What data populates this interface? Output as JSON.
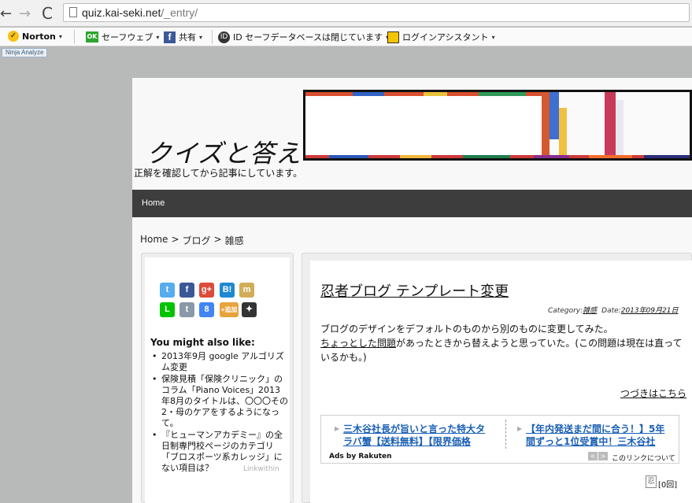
{
  "browser": {
    "url_host": "quiz.kai-seki.net",
    "url_path": "/_entry/",
    "back_icon": "←",
    "forward_icon": "→",
    "reload_icon": "C"
  },
  "toolbar": {
    "norton_label": "Norton",
    "safeweb_label": "セーフウェブ",
    "share_label": "共有",
    "id_safe_label": "ID セーフデータベースは閉じています",
    "login_assistant_label": "ログインアシスタント",
    "ok_badge": "OK",
    "fb_badge": "f",
    "id_badge": "ID",
    "caret": "▾"
  },
  "ninja_analyze_label": "Ninja Analyze",
  "site": {
    "title": "クイズと答え",
    "description": "正解を確認してから記事にしています。"
  },
  "nav": {
    "home_label": "Home"
  },
  "breadcrumb": {
    "items": [
      "Home",
      "ブログ",
      "雑感"
    ],
    "separator": ">"
  },
  "sidebar": {
    "share_icons": [
      {
        "name": "twitter-icon",
        "glyph": "t",
        "color": "#55acee"
      },
      {
        "name": "facebook-icon",
        "glyph": "f",
        "color": "#3b5998"
      },
      {
        "name": "google-plus-icon",
        "glyph": "g+",
        "color": "#dd4b39"
      },
      {
        "name": "hatena-bookmark-icon",
        "glyph": "B!",
        "color": "#1e88d3"
      },
      {
        "name": "mixi-icon",
        "glyph": "m",
        "color": "#d1ad59"
      },
      {
        "name": "line-icon",
        "glyph": "L",
        "color": "#00c300"
      },
      {
        "name": "tumblr-icon",
        "glyph": "t",
        "color": "#8a98a8"
      },
      {
        "name": "google-bookmark-icon",
        "glyph": "8",
        "color": "#4285f4"
      },
      {
        "name": "add-button-icon",
        "glyph": "+追加",
        "color": "#e8a33c"
      },
      {
        "name": "ninja-star-icon",
        "glyph": "✦",
        "color": "#333333"
      }
    ],
    "ymal_title": "You might also like:",
    "ymal_items": [
      "2013年9月 google アルゴリズム変更",
      "保険見積「保険クリニック」のコラム「Piano Voices」2013年8月のタイトルは、〇〇〇その2・母のケアをするようになって。",
      "『ヒューマンアカデミー』の全日制専門校ページのカテゴリ「ブロスポーツ系カレッジ」にない項目は？"
    ],
    "linkwithin_label": "Linkwithin"
  },
  "post": {
    "title": "忍者ブログ テンプレート変更",
    "category_label": "Category:",
    "category_value": "雑感",
    "date_label": "Date:",
    "date_value": "2013年09月21日",
    "body_line1": "ブログのデザインをデフォルトのものから別のものに変更してみた。",
    "body_link": "ちょっとした問題",
    "body_line2": "があったときから替えようと思っていた。(この問題は現在は直っているかも。)",
    "read_more": "つづきはこちら"
  },
  "ad": {
    "left_link": "三木谷社長が旨いと言った特大タラバ蟹【送料無料】【限界価格",
    "right_link": "【年内発送まだ間に合う！】5年間ずっと1位受賞中！三木谷社",
    "ads_by": "Ads by Rakuten",
    "prev": "<",
    "next": ">",
    "about": "このリンクについて"
  },
  "footer": {
    "icon_glyph": "忍",
    "text": "[0回]"
  }
}
